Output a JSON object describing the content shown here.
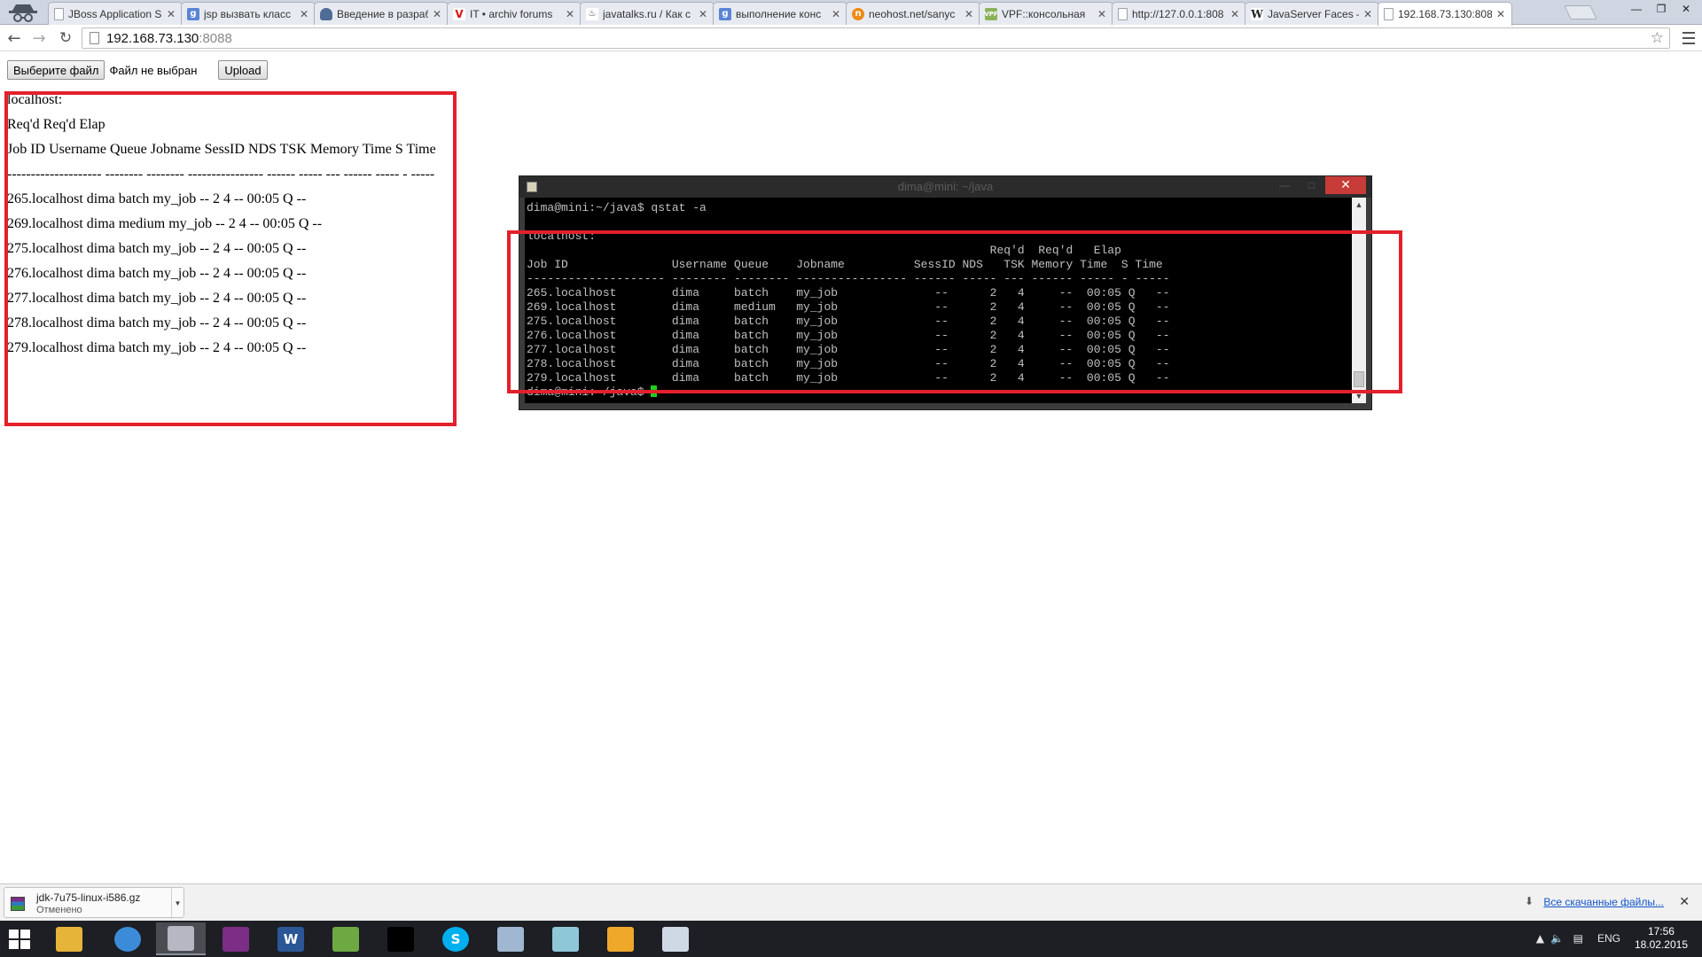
{
  "browser": {
    "tabs": [
      {
        "title": "JBoss Application S",
        "favicon": "document-icon",
        "active": false
      },
      {
        "title": "jsp вызвать класс",
        "favicon": "google-icon",
        "active": false
      },
      {
        "title": "Введение в разраб",
        "favicon": "shield-icon",
        "active": false
      },
      {
        "title": "IT • archiv forums",
        "favicon": "v-icon",
        "active": false
      },
      {
        "title": "javatalks.ru / Как с",
        "favicon": "java-icon",
        "active": false
      },
      {
        "title": "выполнение конс",
        "favicon": "google-icon",
        "active": false
      },
      {
        "title": "neohost.net/sanyc",
        "favicon": "neohost-icon",
        "active": false
      },
      {
        "title": "VPF::консольная",
        "favicon": "vpf-icon",
        "active": false
      },
      {
        "title": "http://127.0.0.1:808",
        "favicon": "document-icon",
        "active": false
      },
      {
        "title": "JavaServer Faces —",
        "favicon": "wikipedia-icon",
        "active": false
      },
      {
        "title": "192.168.73.130:8088",
        "favicon": "document-icon",
        "active": true
      }
    ],
    "address": {
      "host": "192.168.73.130",
      "port": ":8088"
    }
  },
  "page": {
    "choose_file_label": "Выберите файл",
    "file_status": "Файл не выбран",
    "upload_label": "Upload",
    "result_lines": [
      "localhost:",
      "Req'd Req'd Elap",
      "Job ID Username Queue Jobname SessID NDS TSK Memory Time S Time",
      "-------------------- -------- -------- ---------------- ------ ----- --- ------ ----- - -----",
      "265.localhost dima batch my_job -- 2 4 -- 00:05 Q --",
      "269.localhost dima medium my_job -- 2 4 -- 00:05 Q --",
      "275.localhost dima batch my_job -- 2 4 -- 00:05 Q --",
      "276.localhost dima batch my_job -- 2 4 -- 00:05 Q --",
      "277.localhost dima batch my_job -- 2 4 -- 00:05 Q --",
      "278.localhost dima batch my_job -- 2 4 -- 00:05 Q --",
      "279.localhost dima batch my_job -- 2 4 -- 00:05 Q --"
    ]
  },
  "terminal": {
    "title": "dima@mini: ~/java",
    "command_line": "dima@mini:~/java$ qstat -a",
    "host_line": "localhost:",
    "header1": "                                                                   Req'd  Req'd   Elap",
    "header2": "Job ID               Username Queue    Jobname          SessID NDS   TSK Memory Time  S Time",
    "separator": "-------------------- -------- -------- ---------------- ------ ----- --- ------ ----- - -----",
    "rows": [
      "265.localhost        dima     batch    my_job              --      2   4     --  00:05 Q   --",
      "269.localhost        dima     medium   my_job              --      2   4     --  00:05 Q   --",
      "275.localhost        dima     batch    my_job              --      2   4     --  00:05 Q   --",
      "276.localhost        dima     batch    my_job              --      2   4     --  00:05 Q   --",
      "277.localhost        dima     batch    my_job              --      2   4     --  00:05 Q   --",
      "278.localhost        dima     batch    my_job              --      2   4     --  00:05 Q   --",
      "279.localhost        dima     batch    my_job              --      2   4     --  00:05 Q   --"
    ],
    "prompt": "dima@mini:~/java$ "
  },
  "downloads": {
    "file_name": "jdk-7u75-linux-i586.gz",
    "status": "Отменено",
    "show_all": "Все скачанные файлы..."
  },
  "taskbar": {
    "apps": [
      {
        "name": "file-explorer-icon",
        "color": "#e7b43a",
        "glyph": ""
      },
      {
        "name": "chrome-icon",
        "color": "#3c8bd9",
        "glyph": ""
      },
      {
        "name": "putty-icon",
        "color": "#b7b7c4",
        "glyph": ""
      },
      {
        "name": "winrar-icon",
        "color": "#7c2d86",
        "glyph": ""
      },
      {
        "name": "word-icon",
        "color": "#2b5797",
        "glyph": "W"
      },
      {
        "name": "notepad-icon",
        "color": "#6ea843",
        "glyph": ""
      },
      {
        "name": "cmd-icon",
        "color": "#000000",
        "glyph": ""
      },
      {
        "name": "skype-icon",
        "color": "#00aff0",
        "glyph": "S"
      },
      {
        "name": "virtualbox-icon",
        "color": "#9fb7d0",
        "glyph": ""
      },
      {
        "name": "eraser-icon",
        "color": "#8ec7d8",
        "glyph": ""
      },
      {
        "name": "window-app-icon",
        "color": "#f0a82a",
        "glyph": ""
      },
      {
        "name": "paint-icon",
        "color": "#cfd9e6",
        "glyph": ""
      }
    ],
    "language": "ENG",
    "time": "17:56",
    "date": "18.02.2015"
  },
  "colors": {
    "highlight_box": "#e3202c",
    "terminal_bg": "#000000",
    "cursor": "#1bd11b"
  }
}
